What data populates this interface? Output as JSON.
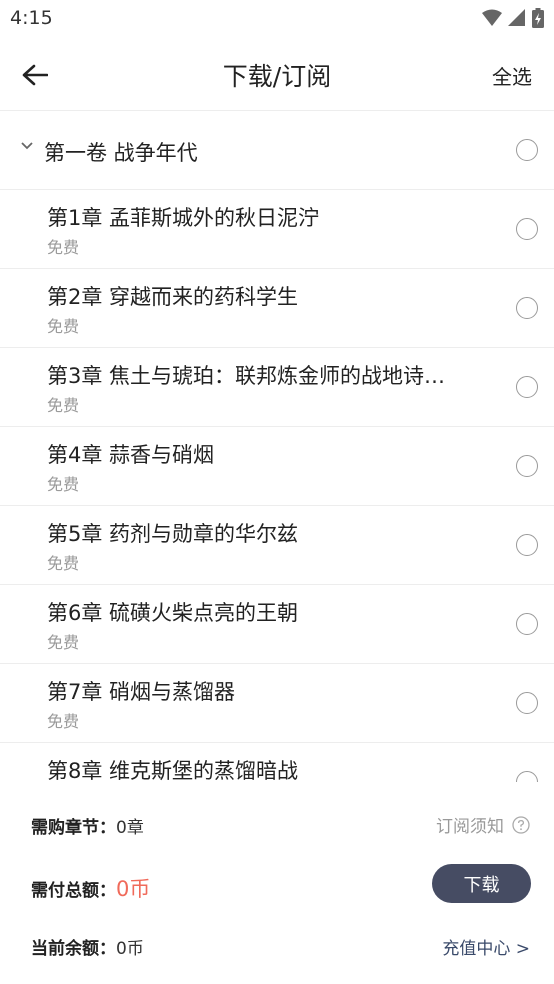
{
  "status": {
    "time": "4:15"
  },
  "header": {
    "title": "下载/订阅",
    "select_all": "全选"
  },
  "volume": {
    "title": "第一卷 战争年代"
  },
  "chapters": [
    {
      "title": "第1章 孟菲斯城外的秋日泥泞",
      "price": "免费"
    },
    {
      "title": "第2章 穿越而来的药科学生",
      "price": "免费"
    },
    {
      "title": "第3章 焦土与琥珀：联邦炼金师的战地诗…",
      "price": "免费"
    },
    {
      "title": "第4章 蒜香与硝烟",
      "price": "免费"
    },
    {
      "title": "第5章 药剂与勋章的华尔兹",
      "price": "免费"
    },
    {
      "title": "第6章 硫磺火柴点亮的王朝",
      "price": "免费"
    },
    {
      "title": "第7章 硝烟与蒸馏器",
      "price": "免费"
    },
    {
      "title": "第8章 维克斯堡的蒸馏暗战",
      "price": ""
    }
  ],
  "footer": {
    "chapters_label": "需购章节：",
    "chapters_value": "0章",
    "notice": "订阅须知",
    "total_label": "需付总额：",
    "total_value": "0币",
    "download": "下载",
    "balance_label": "当前余额：",
    "balance_value": "0币",
    "recharge": "充值中心 >"
  },
  "colors": {
    "accent_red": "#f06a5a",
    "button": "#464c63",
    "link": "#3a4a6a"
  }
}
